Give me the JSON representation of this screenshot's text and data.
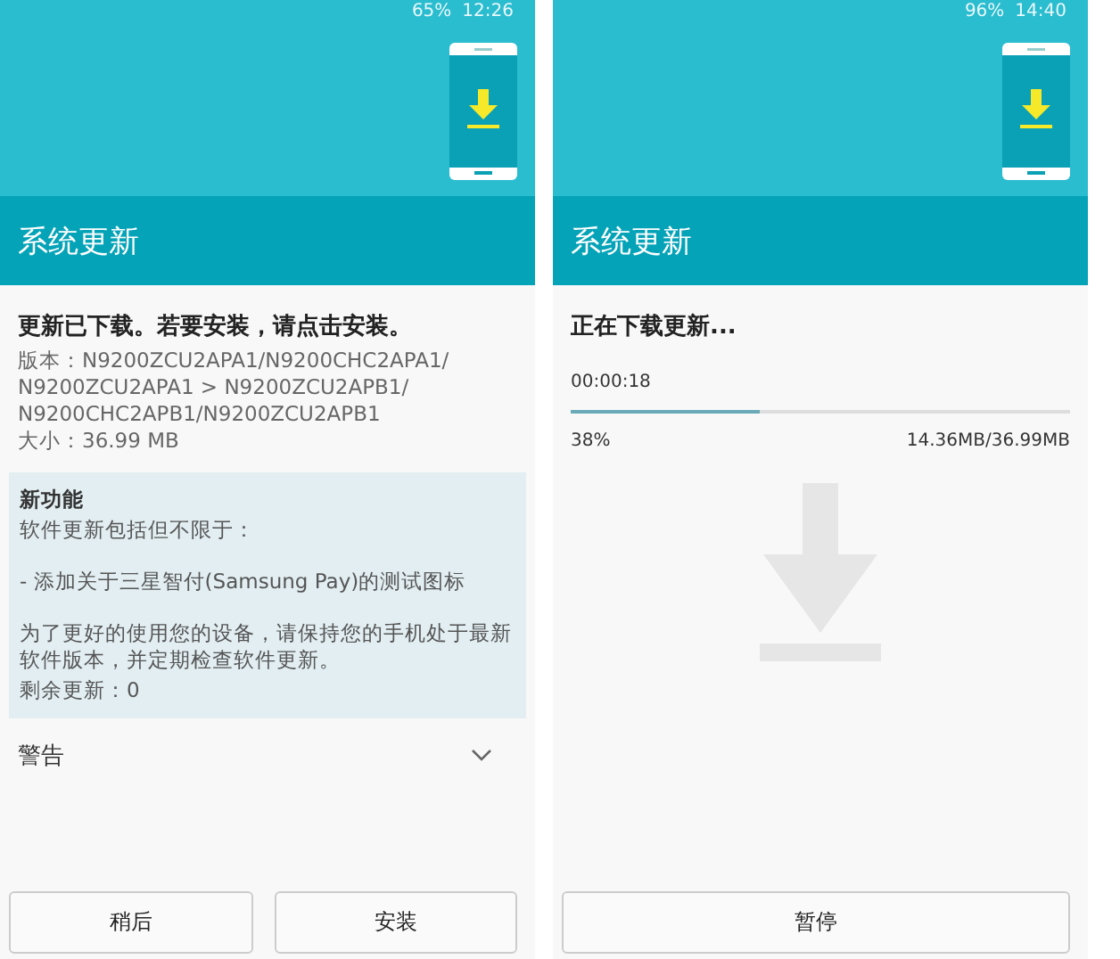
{
  "screens": [
    {
      "kind": "ready",
      "status_bar": {
        "battery": "65%",
        "time": "12:26"
      },
      "title": "系统更新",
      "heading": "更新已下载。若要安装，请点击安装。",
      "details": [
        "版本：N9200ZCU2APA1/N9200CHC2APA1/ N9200ZCU2APA1 > N9200ZCU2APB1/ N9200CHC2APB1/N9200ZCU2APB1",
        "大小：36.99 MB"
      ],
      "notes": {
        "heading": "新功能",
        "lines": [
          "软件更新包括但不限于：",
          "- 添加关于三星智付(Samsung Pay)的测试图标",
          "为了更好的使用您的设备，请保持您的手机处于最新软件版本，并定期检查软件更新。",
          "剩余更新：0"
        ]
      },
      "warning": {
        "label": "警告",
        "expanded": false
      },
      "buttons": [
        "稍后",
        "安装"
      ]
    },
    {
      "kind": "downloading",
      "status_bar": {
        "battery": "96%",
        "time": "14:40"
      },
      "title": "系统更新",
      "heading": "正在下载更新...",
      "elapsed": "00:00:18",
      "progress": {
        "level": 0.38,
        "percent": "38%",
        "amount": "14.36MB/36.99MB"
      },
      "buttons": [
        "暂停"
      ]
    }
  ]
}
